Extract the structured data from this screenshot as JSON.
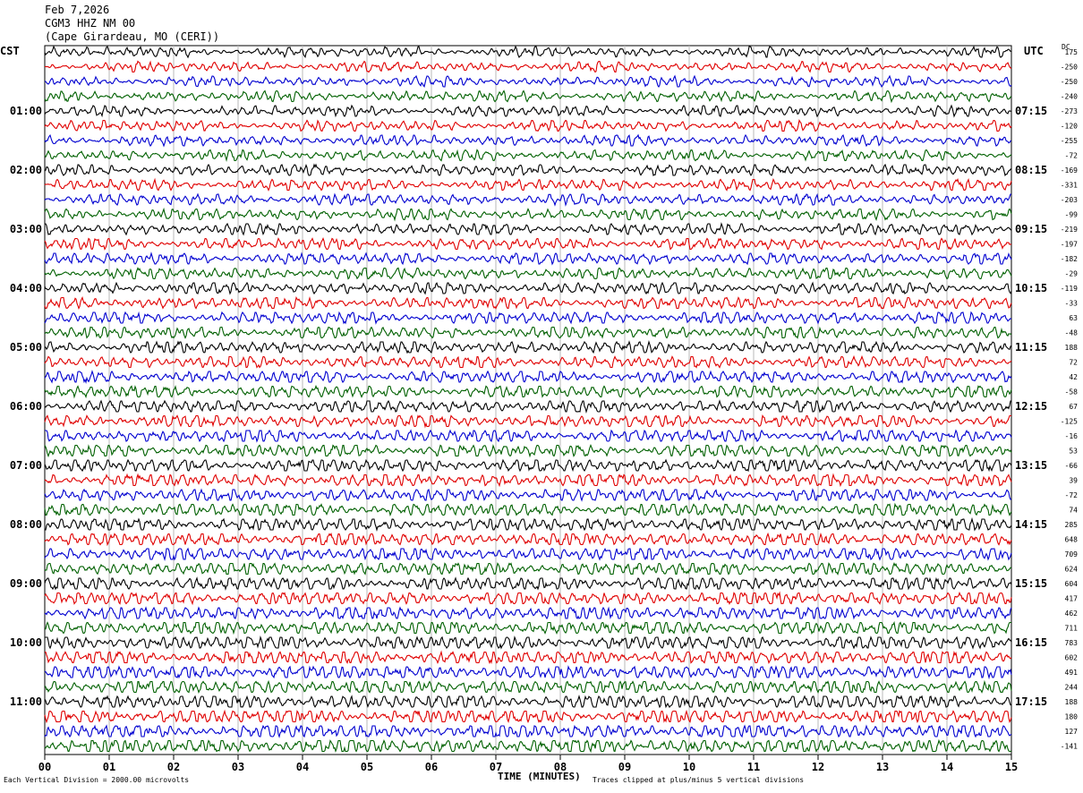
{
  "header": {
    "date": "Feb 7,2026",
    "station": "CGM3 HHZ NM 00",
    "location": "(Cape Girardeau, MO (CERI))"
  },
  "left_axis_label": "CST",
  "right_axis_label": "UTC",
  "dc_label": "DC",
  "footer": {
    "scale_note": "Each Vertical Division = 2000.00 microvolts",
    "time_label": "TIME (MINUTES)",
    "clip_note": "Traces clipped at plus/minus 5 vertical divisions"
  },
  "chart_data": {
    "type": "line",
    "title": "",
    "xlabel": "TIME (MINUTES)",
    "xlim": [
      0,
      15
    ],
    "x_ticks": [
      "00",
      "01",
      "02",
      "03",
      "04",
      "05",
      "06",
      "07",
      "08",
      "09",
      "10",
      "11",
      "12",
      "13",
      "14",
      "15"
    ],
    "grid": true,
    "trace_colors": [
      "#000000",
      "#e00000",
      "#0000d0",
      "#006000"
    ],
    "cst_hour_labels": [
      "01:00",
      "02:00",
      "03:00",
      "04:00",
      "05:00",
      "06:00",
      "07:00",
      "08:00",
      "09:00",
      "10:00",
      "11:00"
    ],
    "utc_hour_labels": [
      "07:15",
      "08:15",
      "09:15",
      "10:15",
      "11:15",
      "12:15",
      "13:15",
      "14:15",
      "15:15",
      "16:15",
      "17:15"
    ],
    "dc_offsets": [
      175,
      -250,
      -250,
      -240,
      -273,
      -120,
      -255,
      -72,
      -169,
      -331,
      -203,
      -99,
      -219,
      -197,
      -182,
      -29,
      -119,
      -33,
      63,
      -48,
      188,
      72,
      42,
      -58,
      67,
      -125,
      -16,
      53,
      -66,
      39,
      -72,
      74,
      285,
      648,
      709,
      624,
      604,
      417,
      462,
      711,
      783,
      602,
      491,
      244,
      188,
      180,
      127,
      -141
    ]
  }
}
